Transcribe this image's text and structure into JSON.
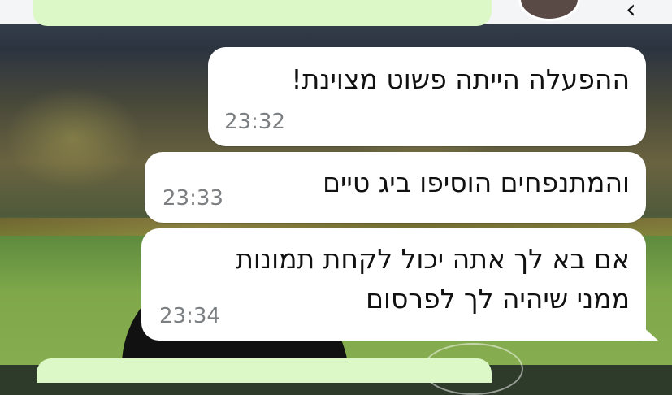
{
  "messages": [
    {
      "text": "ההפעלה הייתה פשוט מצוינת!",
      "time": "23:32"
    },
    {
      "text": "והמתנפחים הוסיפו ביג טיים",
      "time": "23:33"
    },
    {
      "lines": [
        "אם בא לך אתה יכול לקחת תמונות",
        "ממני שיהיה לך לפרסום"
      ],
      "time": "23:34"
    }
  ],
  "colors": {
    "incoming_bubble": "#ffffff",
    "outgoing_bubble": "#dcf8c6",
    "timestamp": "#7c7f82"
  }
}
